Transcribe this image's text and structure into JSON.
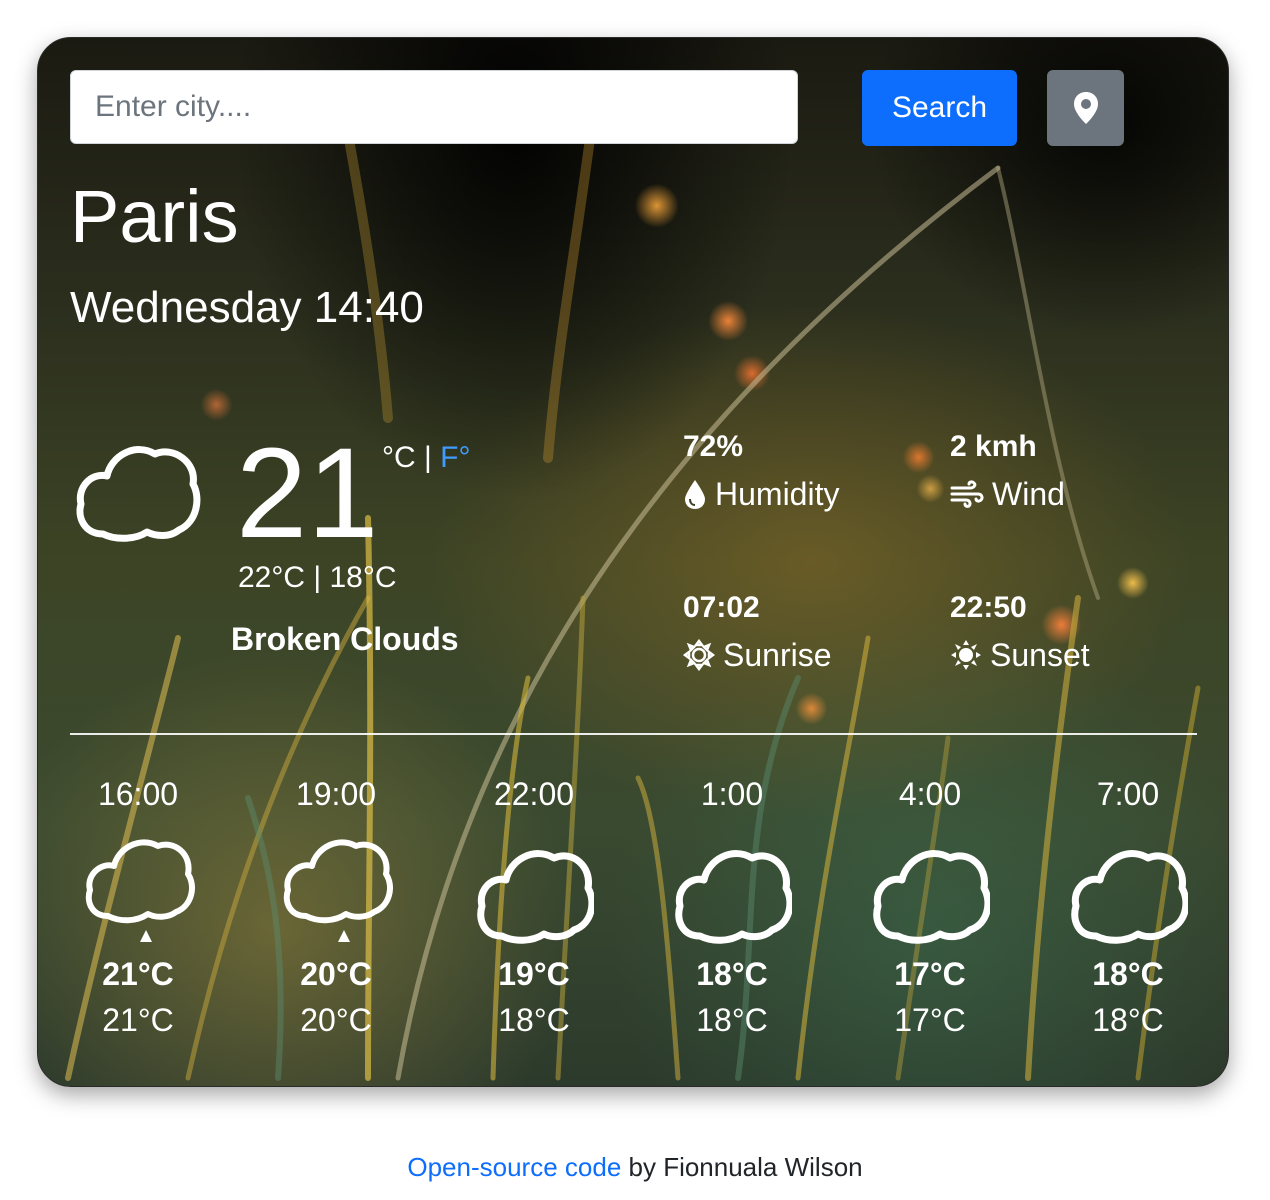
{
  "search": {
    "placeholder": "Enter city....",
    "button_label": "Search",
    "location_icon": "map-pin-icon"
  },
  "current": {
    "city": "Paris",
    "datetime": "Wednesday 14:40",
    "icon": "cloud-icon",
    "temperature": "21",
    "unit_celsius": "°C",
    "unit_separator": " | ",
    "unit_fahrenheit": "F°",
    "high_low": "22°C | 18°C",
    "description": "Broken Clouds"
  },
  "stats": {
    "humidity": {
      "value": "72%",
      "label": "Humidity",
      "icon": "droplet-icon"
    },
    "wind": {
      "value": "2 kmh",
      "label": "Wind",
      "icon": "wind-icon"
    },
    "sunrise": {
      "value": "07:02",
      "label": "Sunrise",
      "icon": "sunrise-icon"
    },
    "sunset": {
      "value": "22:50",
      "label": "Sunset",
      "icon": "sunset-icon"
    }
  },
  "forecast": [
    {
      "time": "16:00",
      "max": "21°C",
      "min": "21°C",
      "icon": "cloud-rain-icon"
    },
    {
      "time": "19:00",
      "max": "20°C",
      "min": "20°C",
      "icon": "cloud-rain-icon"
    },
    {
      "time": "22:00",
      "max": "19°C",
      "min": "18°C",
      "icon": "cloud-icon"
    },
    {
      "time": "1:00",
      "max": "18°C",
      "min": "18°C",
      "icon": "cloud-icon"
    },
    {
      "time": "4:00",
      "max": "17°C",
      "min": "17°C",
      "icon": "cloud-icon"
    },
    {
      "time": "7:00",
      "max": "18°C",
      "min": "18°C",
      "icon": "cloud-icon"
    }
  ],
  "footer": {
    "link_text": "Open-source code",
    "suffix": " by Fionnuala Wilson"
  },
  "colors": {
    "primary": "#0d6efd",
    "secondary": "#6c757d",
    "fahrenheit_link": "#3f9bff"
  }
}
